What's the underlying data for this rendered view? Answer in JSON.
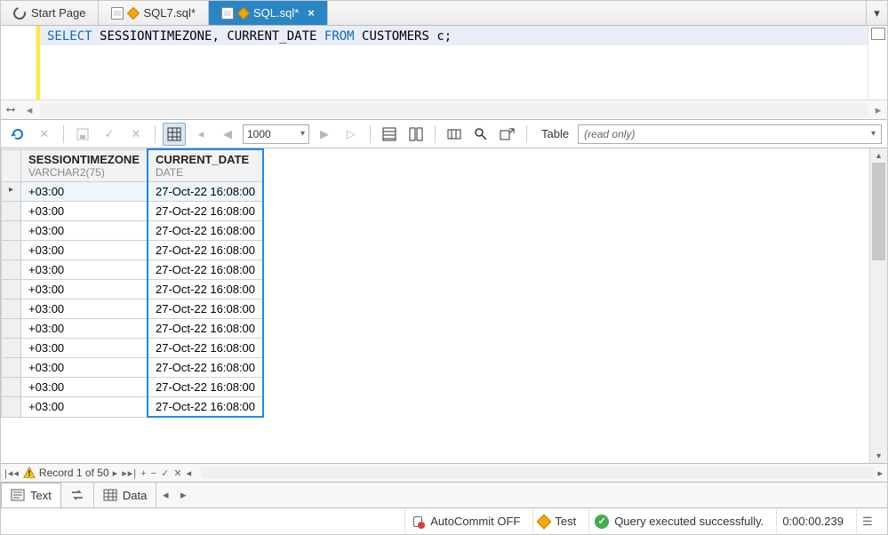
{
  "tabs": [
    {
      "label": "Start Page",
      "kind": "start"
    },
    {
      "label": "SQL7.sql*",
      "kind": "sql"
    },
    {
      "label": "SQL.sql*",
      "kind": "sql",
      "active": true
    }
  ],
  "sql": {
    "kw1": "SELECT",
    "id1": "SESSIONTIMEZONE",
    "comma": ", ",
    "id2": "CURRENT_DATE",
    "kw2": " FROM ",
    "id3": "CUSTOMERS c",
    "semi": ";"
  },
  "toolbar": {
    "row_limit": "1000",
    "table_label": "Table",
    "readonly_text": "(read only)"
  },
  "columns": [
    {
      "name": "SESSIONTIMEZONE",
      "type": "VARCHAR2(75)",
      "highlight": false
    },
    {
      "name": "CURRENT_DATE",
      "type": "DATE",
      "highlight": true
    }
  ],
  "rows": [
    {
      "c0": "+03:00",
      "c1": "27-Oct-22 16:08:00",
      "sel": true
    },
    {
      "c0": "+03:00",
      "c1": "27-Oct-22 16:08:00"
    },
    {
      "c0": "+03:00",
      "c1": "27-Oct-22 16:08:00"
    },
    {
      "c0": "+03:00",
      "c1": "27-Oct-22 16:08:00"
    },
    {
      "c0": "+03:00",
      "c1": "27-Oct-22 16:08:00"
    },
    {
      "c0": "+03:00",
      "c1": "27-Oct-22 16:08:00"
    },
    {
      "c0": "+03:00",
      "c1": "27-Oct-22 16:08:00"
    },
    {
      "c0": "+03:00",
      "c1": "27-Oct-22 16:08:00"
    },
    {
      "c0": "+03:00",
      "c1": "27-Oct-22 16:08:00"
    },
    {
      "c0": "+03:00",
      "c1": "27-Oct-22 16:08:00"
    },
    {
      "c0": "+03:00",
      "c1": "27-Oct-22 16:08:00"
    },
    {
      "c0": "+03:00",
      "c1": "27-Oct-22 16:08:00",
      "lastvis": true
    }
  ],
  "record_nav": {
    "text": "Record 1 of 50"
  },
  "output_tabs": {
    "text": "Text",
    "data": "Data"
  },
  "status": {
    "autocommit": "AutoCommit OFF",
    "connection": "Test",
    "message": "Query executed successfully.",
    "elapsed": "0:00:00.239"
  }
}
